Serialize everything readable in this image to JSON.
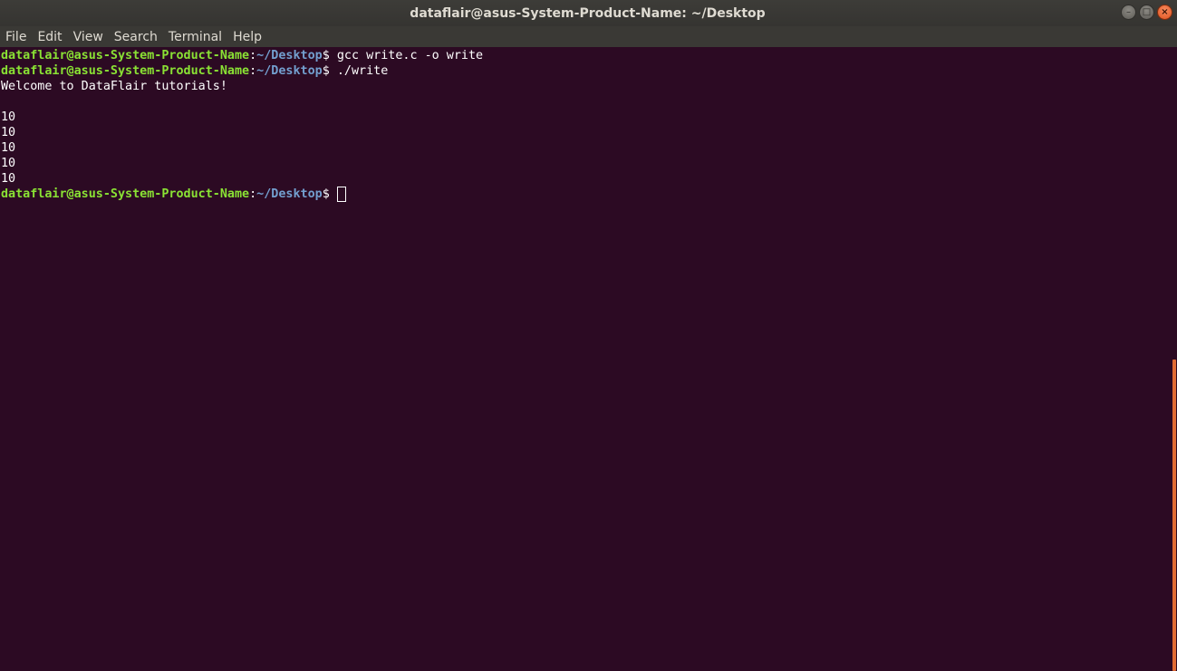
{
  "window": {
    "title": "dataflair@asus-System-Product-Name: ~/Desktop",
    "controls": {
      "minimize": "–",
      "maximize": "□",
      "close": "×"
    }
  },
  "menu": {
    "items": [
      "File",
      "Edit",
      "View",
      "Search",
      "Terminal",
      "Help"
    ]
  },
  "terminal": {
    "prompt": {
      "user_host": "dataflair@asus-System-Product-Name",
      "separator": ":",
      "path": "~/Desktop",
      "symbol": "$"
    },
    "lines": [
      {
        "type": "command",
        "text": " gcc write.c -o write"
      },
      {
        "type": "command",
        "text": " ./write"
      },
      {
        "type": "output",
        "text": "Welcome to DataFlair tutorials!"
      },
      {
        "type": "output",
        "text": ""
      },
      {
        "type": "output",
        "text": "10"
      },
      {
        "type": "output",
        "text": "10"
      },
      {
        "type": "output",
        "text": "10"
      },
      {
        "type": "output",
        "text": "10"
      },
      {
        "type": "output",
        "text": "10"
      },
      {
        "type": "prompt",
        "text": " "
      }
    ]
  },
  "colors": {
    "background": "#2c0a23",
    "user_host": "#8ae234",
    "path": "#739fcf",
    "text": "#ffffff",
    "scrollbar_thumb": "#e06b34"
  }
}
